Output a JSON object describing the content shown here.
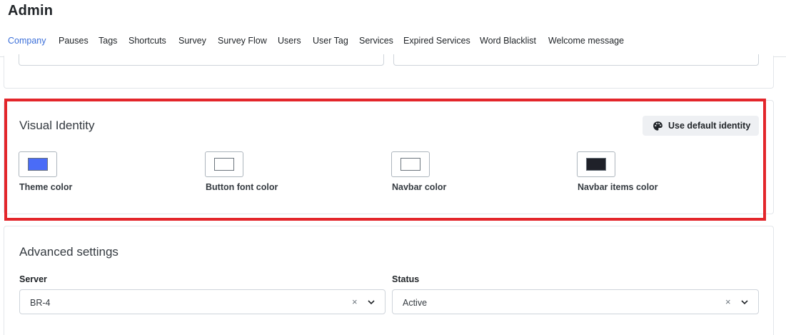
{
  "header": {
    "title": "Admin"
  },
  "tabs": [
    {
      "label": "Company",
      "active": true
    },
    {
      "label": "Pauses"
    },
    {
      "label": "Tags"
    },
    {
      "label": "Shortcuts"
    },
    {
      "label": "Survey"
    },
    {
      "label": "Survey Flow"
    },
    {
      "label": "Users"
    },
    {
      "label": "User Tag"
    },
    {
      "label": "Services"
    },
    {
      "label": "Expired Services"
    },
    {
      "label": "Word Blacklist"
    },
    {
      "label": "Welcome message"
    }
  ],
  "visual_identity": {
    "title": "Visual Identity",
    "default_button": {
      "label": "Use default identity",
      "icon": "palette-icon"
    },
    "colors": [
      {
        "label": "Theme color",
        "value": "#4a6cf7"
      },
      {
        "label": "Button font color",
        "value": "#ffffff"
      },
      {
        "label": "Navbar color",
        "value": "#ffffff"
      },
      {
        "label": "Navbar items color",
        "value": "#1f2129"
      }
    ]
  },
  "advanced": {
    "title": "Advanced settings",
    "server": {
      "label": "Server",
      "value": "BR-4"
    },
    "status": {
      "label": "Status",
      "value": "Active"
    },
    "clear_glyph": "×"
  },
  "colors": {
    "accent": "#3b6fd9",
    "highlight": "#e3262b"
  }
}
